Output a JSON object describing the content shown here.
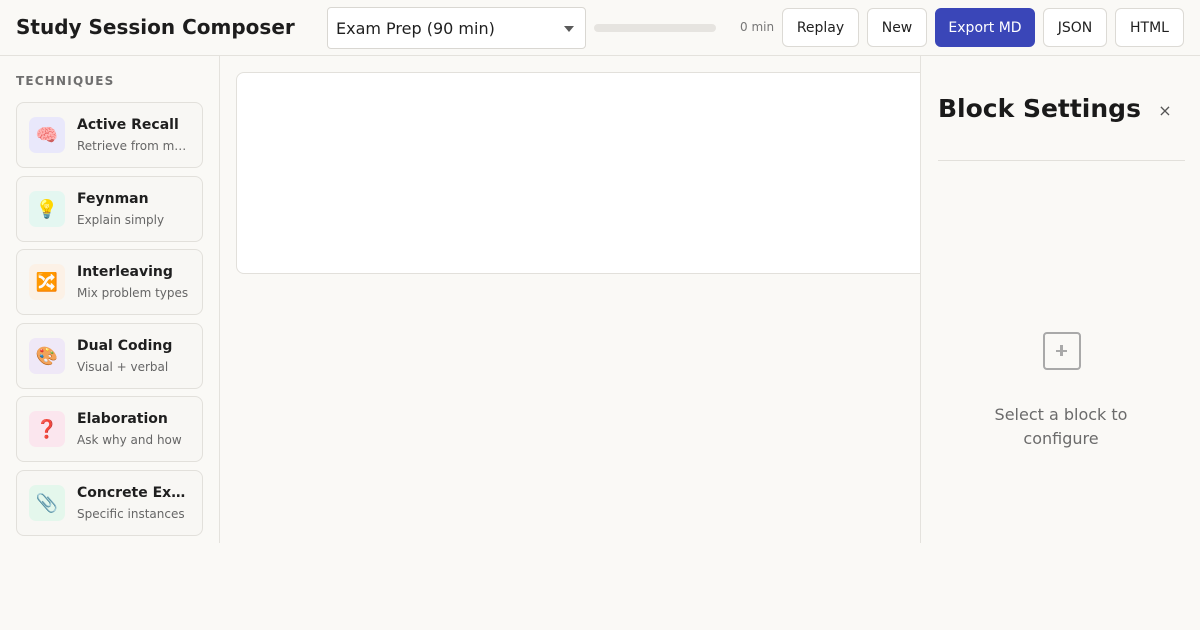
{
  "app": {
    "title": "Study Session Composer"
  },
  "toolbar": {
    "preset_value": "Exam Prep (90 min)",
    "progress_fraction": 0,
    "minutes_label": "0 min",
    "replay_label": "Replay",
    "new_label": "New",
    "export_md_label": "Export MD",
    "json_label": "JSON",
    "html_label": "HTML",
    "accent_color": "#3a46b8"
  },
  "sidebar": {
    "heading": "TECHNIQUES",
    "items": [
      {
        "name": "Active Recall",
        "desc": "Retrieve from memory",
        "icon": "🧠",
        "icon_name": "brain-icon",
        "icon_bg": "#e9e8fb"
      },
      {
        "name": "Feynman",
        "desc": "Explain simply",
        "icon": "💡",
        "icon_name": "lightbulb-icon",
        "icon_bg": "#e4f7f1"
      },
      {
        "name": "Interleaving",
        "desc": "Mix problem types",
        "icon": "🔀",
        "icon_name": "shuffle-icon",
        "icon_bg": "#fcf1e6"
      },
      {
        "name": "Dual Coding",
        "desc": "Visual + verbal",
        "icon": "🎨",
        "icon_name": "palette-icon",
        "icon_bg": "#efe8f7"
      },
      {
        "name": "Elaboration",
        "desc": "Ask why and how",
        "icon": "❓",
        "icon_name": "question-icon",
        "icon_bg": "#fbe6ee"
      },
      {
        "name": "Concrete Examples",
        "desc": "Specific instances",
        "icon": "📎",
        "icon_name": "paperclip-icon",
        "icon_bg": "#e4f7ec"
      }
    ]
  },
  "settings": {
    "title": "Block Settings",
    "close_glyph": "×",
    "empty_message": "Select a block to configure",
    "empty_icon": "add-square-icon"
  }
}
